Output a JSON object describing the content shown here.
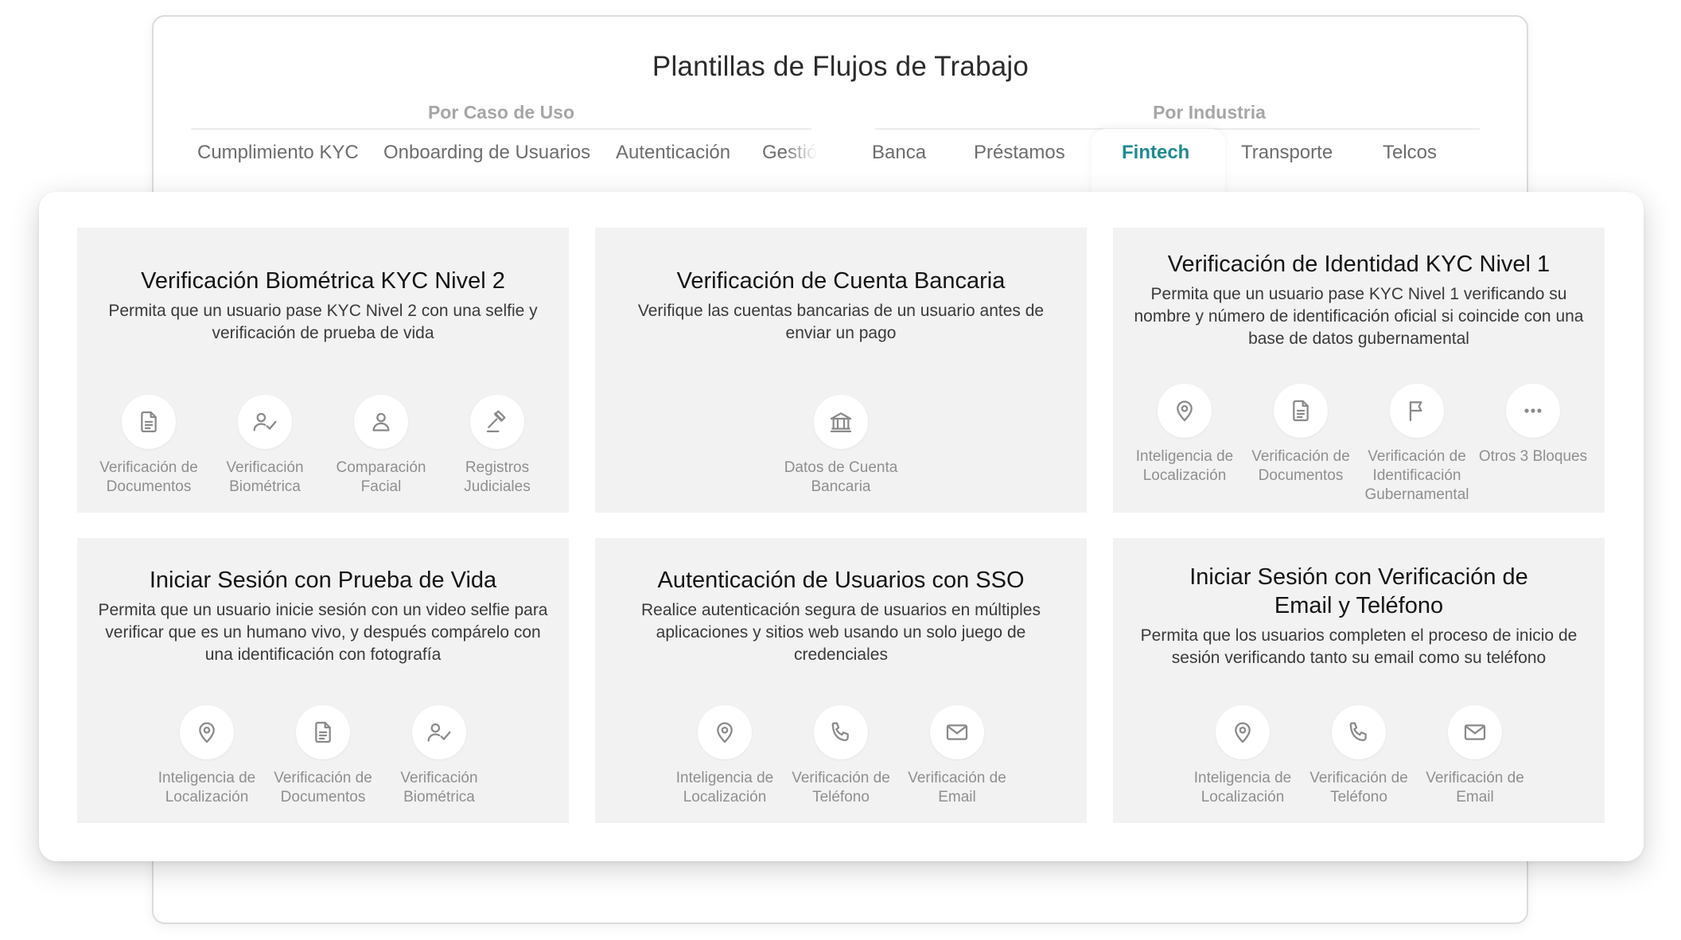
{
  "title": "Plantillas de Flujos de Trabajo",
  "groups": {
    "use_case": "Por Caso de Uso",
    "industry": "Por Industria"
  },
  "tabs": {
    "kyc": "Cumplimiento KYC",
    "onboarding": "Onboarding de Usuarios",
    "auth": "Autenticación",
    "gest": "Gestió",
    "banca": "Banca",
    "prestamos": "Préstamos",
    "fintech": "Fintech",
    "transporte": "Transporte",
    "telcos": "Telcos"
  },
  "active_tab": "Fintech",
  "accent_color": "#1e8a94",
  "cards": [
    {
      "title": "Verificación Biométrica KYC Nivel 2",
      "desc": "Permita que un usuario pase KYC Nivel 2 con una selfie y verificación de prueba de vida",
      "blocks": [
        {
          "icon": "document-icon",
          "label": "Verificación de Documentos"
        },
        {
          "icon": "biometric-icon",
          "label": "Verificación Biométrica"
        },
        {
          "icon": "face-icon",
          "label": "Comparación Facial"
        },
        {
          "icon": "gavel-icon",
          "label": "Registros Judiciales"
        }
      ]
    },
    {
      "title": "Verificación de Cuenta Bancaria",
      "desc": "Verifique las cuentas bancarias de un usuario antes de enviar un pago",
      "blocks": [
        {
          "icon": "bank-icon",
          "label": "Datos de Cuenta Bancaria"
        }
      ]
    },
    {
      "title": "Verificación de Identidad KYC Nivel 1",
      "desc": "Permita que un usuario pase KYC Nivel 1 verificando su nombre y número de identificación oficial si coincide con una base de datos gubernamental",
      "blocks": [
        {
          "icon": "location-icon",
          "label": "Inteligencia de Localización"
        },
        {
          "icon": "document-icon",
          "label": "Verificación de Documentos"
        },
        {
          "icon": "flag-icon",
          "label": "Verificación de Identificación Gubernamental"
        },
        {
          "icon": "more-icon",
          "label": "Otros 3 Bloques"
        }
      ]
    },
    {
      "title": "Iniciar Sesión con Prueba de Vida",
      "desc": "Permita que un usuario inicie sesión con un video selfie para verificar que es un humano vivo, y después compárelo con una identificación con fotografía",
      "blocks": [
        {
          "icon": "location-icon",
          "label": "Inteligencia de Localización"
        },
        {
          "icon": "document-icon",
          "label": "Verificación de Documentos"
        },
        {
          "icon": "biometric-icon",
          "label": "Verificación Biométrica"
        }
      ]
    },
    {
      "title": "Autenticación de Usuarios con SSO",
      "desc": "Realice autenticación segura de usuarios en múltiples aplicaciones y sitios web usando un solo juego de credenciales",
      "blocks": [
        {
          "icon": "location-icon",
          "label": "Inteligencia de Localización"
        },
        {
          "icon": "phone-icon",
          "label": "Verificación de Teléfono"
        },
        {
          "icon": "email-icon",
          "label": "Verificación de Email"
        }
      ]
    },
    {
      "title": "Iniciar Sesión con Verificación de Email y Teléfono",
      "desc": "Permita que los usuarios completen el proceso de inicio de sesión verificando tanto su email como su teléfono",
      "blocks": [
        {
          "icon": "location-icon",
          "label": "Inteligencia de Localización"
        },
        {
          "icon": "phone-icon",
          "label": "Verificación de Teléfono"
        },
        {
          "icon": "email-icon",
          "label": "Verificación de Email"
        }
      ]
    }
  ]
}
